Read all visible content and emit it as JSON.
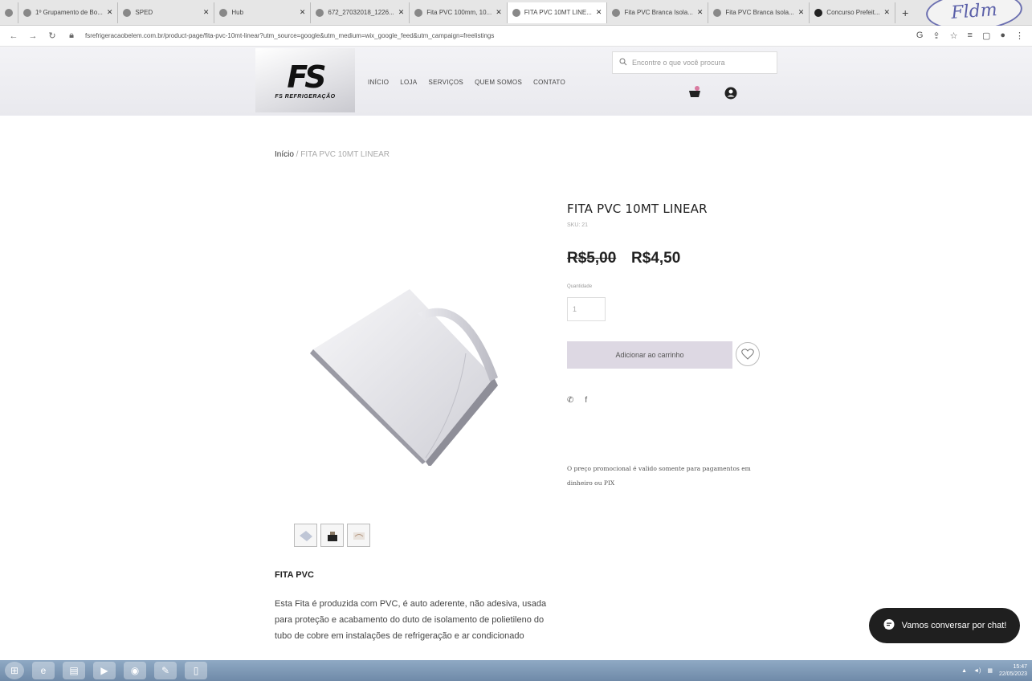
{
  "browser": {
    "tabs": [
      {
        "label": "1º Grupamento de Bo..."
      },
      {
        "label": "SPED"
      },
      {
        "label": "Hub"
      },
      {
        "label": "672_27032018_1226..."
      },
      {
        "label": "Fita PVC 100mm, 10..."
      },
      {
        "label": "FITA PVC 10MT LINE..."
      },
      {
        "label": "Fita PVC Branca Isola..."
      },
      {
        "label": "Fita PVC Branca Isola..."
      },
      {
        "label": "Concurso Prefeit..."
      }
    ],
    "url": "fsrefrigeracaobelem.com.br/product-page/fita-pvc-10mt-linear?utm_source=google&utm_medium=wix_google_feed&utm_campaign=freelistings"
  },
  "stamp_text": "Fldm",
  "header": {
    "logo_mark": "FS",
    "logo_text": "FS REFRIGERAÇÃO",
    "nav": [
      "INÍCIO",
      "LOJA",
      "SERVIÇOS",
      "QUEM SOMOS",
      "CONTATO"
    ],
    "search_placeholder": "Encontre o que você procura"
  },
  "breadcrumb": {
    "home": "Início",
    "separator": " / ",
    "current": "FITA PVC 10MT LINEAR"
  },
  "product": {
    "title": "FITA PVC 10MT LINEAR",
    "sku": "SKU: 21",
    "price_old": "R$5,00",
    "price_new": "R$4,50",
    "quantity_label": "Quantidade",
    "quantity_value": "1",
    "add_to_cart": "Adicionar ao carrinho",
    "promo_note": "O preço promocional é valido somente para pagamentos em dinheiro ou PIX",
    "share_facebook": "f"
  },
  "description": {
    "title": "FITA PVC",
    "text": "Esta Fita é produzida com PVC, é auto aderente, não adesiva, usada para proteção e acabamento do duto de isolamento de polietileno do tubo de cobre em instalações de refrigeração e ar condicionado"
  },
  "chat": {
    "label": "Vamos conversar por chat!"
  },
  "taskbar": {
    "time": "15:47",
    "date": "22/05/2023"
  },
  "colors": {
    "add_to_cart_bg": "#ddd8e3",
    "chat_bg": "#1f1f1f",
    "taskbar": "#7d98b6"
  }
}
